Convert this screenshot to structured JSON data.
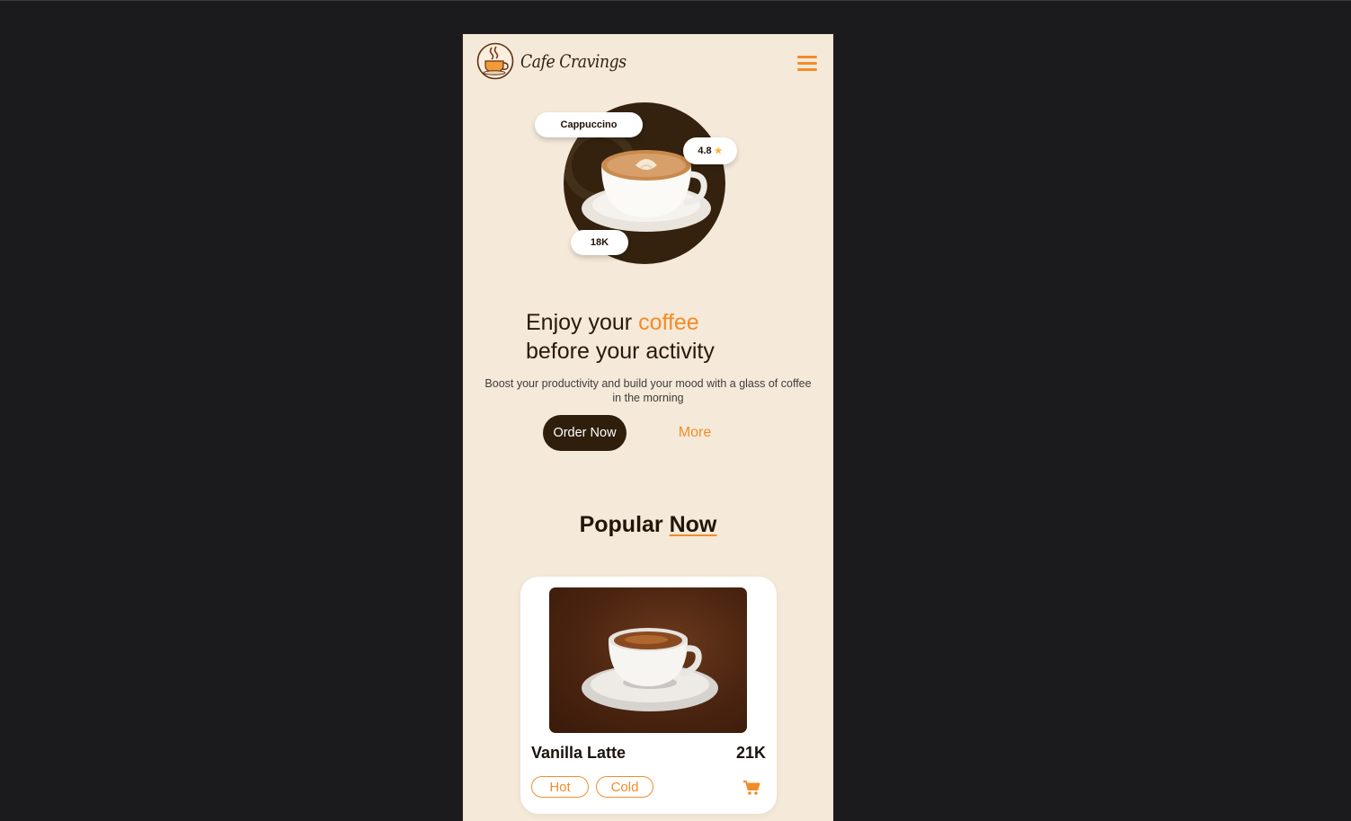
{
  "header": {
    "brand": "Cafe Cravings",
    "logo_icon": "coffee-cup-logo-icon",
    "menu_icon": "hamburger-menu-icon"
  },
  "hero": {
    "product_name": "Cappuccino",
    "rating": "4.8",
    "rating_icon": "star-icon",
    "count": "18K",
    "headline_prefix": "Enjoy your ",
    "headline_accent": "coffee",
    "headline_line2": "before your activity",
    "subtext": "Boost your productivity and build your mood with a glass of coffee in the morning",
    "order_label": "Order Now",
    "more_label": "More"
  },
  "popular": {
    "title_prefix": "Popular ",
    "title_accent": "Now",
    "items": [
      {
        "name": "Vanilla Latte",
        "price": "21K",
        "tags": [
          "Hot",
          "Cold"
        ],
        "cart_icon": "shopping-cart-icon"
      }
    ]
  },
  "colors": {
    "accent": "#f28c28",
    "dark": "#2e1e0b",
    "background": "#f5e9d9"
  }
}
